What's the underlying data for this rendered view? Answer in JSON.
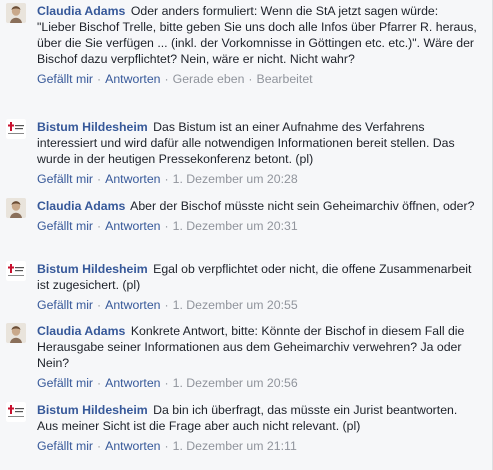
{
  "comments": [
    {
      "author": "Claudia Adams",
      "avatar": "claudia-avatar",
      "text": "Oder anders formuliert: Wenn die StA jetzt sagen würde: \"Lieber Bischof Trelle, bitte geben Sie uns doch alle Infos über Pfarrer R. heraus, über die Sie verfügen ... (inkl. der Vorkomnisse in Göttingen etc. etc.)\". Wäre der Bischof dazu verpflichtet? Nein, wäre er nicht. Nicht wahr?",
      "like": "Gefällt mir",
      "reply": "Antworten",
      "time": "Gerade eben",
      "edit": "Bearbeitet"
    },
    {
      "author": "Bistum Hildesheim",
      "avatar": "bistum-logo",
      "text": "Das Bistum ist an einer Aufnahme des Verfahrens interessiert und wird dafür alle notwendigen Informationen bereit stellen. Das wurde in der heutigen Pressekonferenz betont. (pl)",
      "like": "Gefällt mir",
      "reply": "Antworten",
      "time": "1. Dezember um 20:28"
    },
    {
      "author": "Claudia Adams",
      "avatar": "claudia-avatar",
      "text": "Aber der Bischof müsste nicht sein Geheimarchiv öffnen, oder?",
      "like": "Gefällt mir",
      "reply": "Antworten",
      "time": "1. Dezember um 20:31"
    },
    {
      "author": "Bistum Hildesheim",
      "avatar": "bistum-logo",
      "text": "Egal ob verpflichtet oder nicht, die offene Zusammenarbeit ist zugesichert. (pl)",
      "like": "Gefällt mir",
      "reply": "Antworten",
      "time": "1. Dezember um 20:55"
    },
    {
      "author": "Claudia Adams",
      "avatar": "claudia-avatar",
      "text": "Konkrete Antwort, bitte: Könnte der Bischof in diesem Fall die Herausgabe seiner Informationen aus dem Geheimarchiv verwehren? Ja oder Nein?",
      "like": "Gefällt mir",
      "reply": "Antworten",
      "time": "1. Dezember um 20:56"
    },
    {
      "author": "Bistum Hildesheim",
      "avatar": "bistum-logo",
      "text": "Da bin ich überfragt, das müsste ein Jurist beantworten. Aus meiner Sicht ist die Frage aber auch nicht relevant. (pl)",
      "like": "Gefällt mir",
      "reply": "Antworten",
      "time": "1. Dezember um 21:11"
    }
  ],
  "separator": "·",
  "colors": {
    "link": "#365899",
    "meta": "#90949c",
    "text": "#1d2129",
    "background": "#f6f7f9"
  }
}
